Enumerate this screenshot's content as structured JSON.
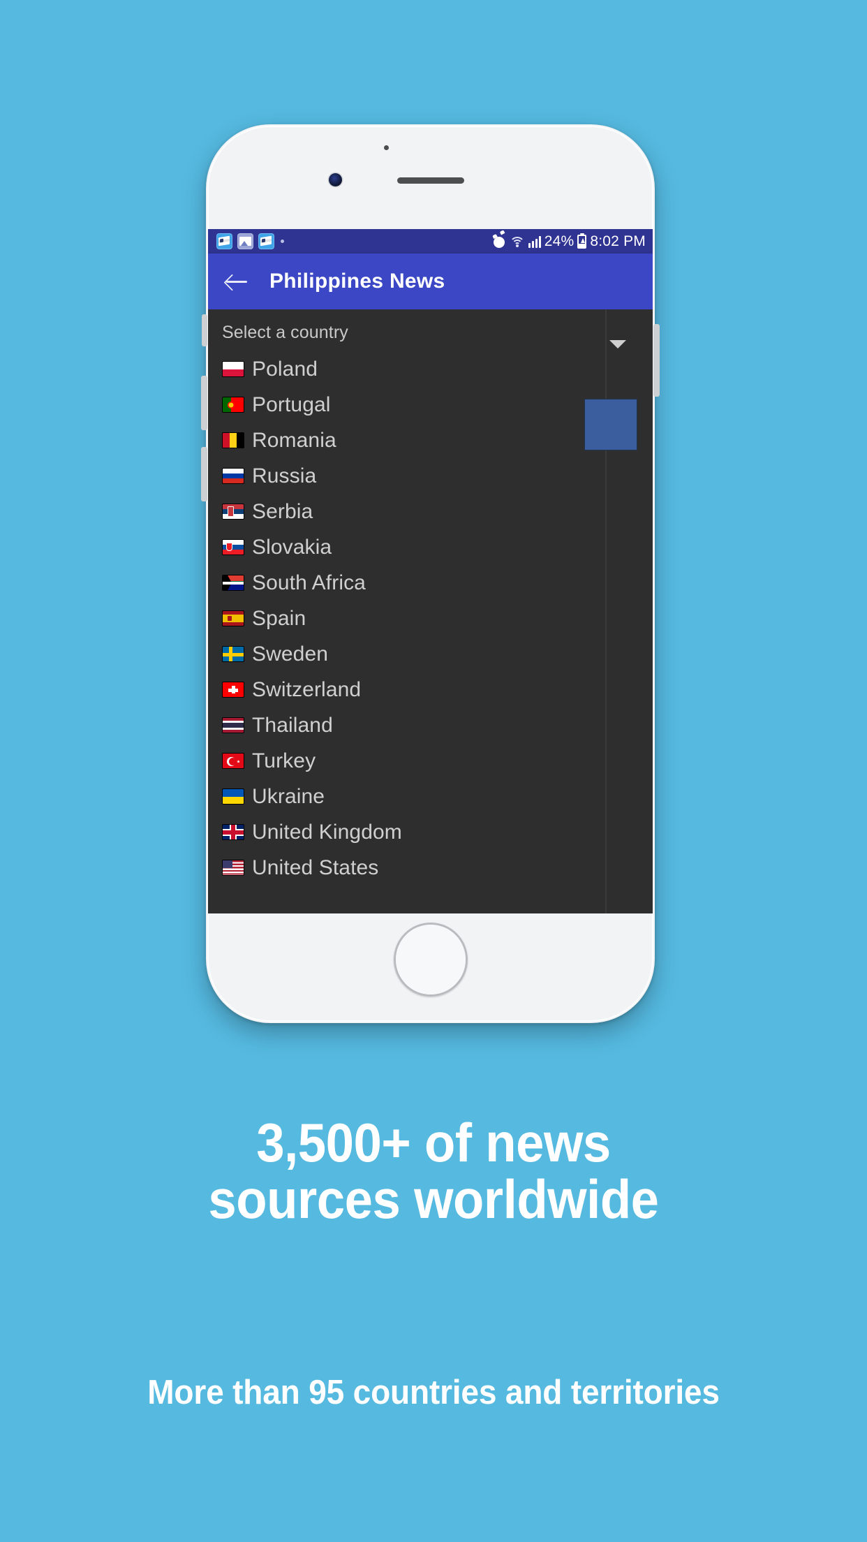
{
  "background_color": "#55b9e0",
  "phone": {
    "device": "white-smartphone-mockup",
    "home_button_name": "home-button"
  },
  "status_bar": {
    "background": "#2f3391",
    "notification_icons": [
      "news-paper-icon",
      "photo-icon",
      "news-paper-icon",
      "more-notifications-dot"
    ],
    "alarm_icon": "alarm-clock-icon",
    "wifi_icon": "wifi-icon",
    "signal_icon": "cell-signal-icon",
    "battery_percent": "24%",
    "battery_icon": "battery-charging-icon",
    "time": "8:02 PM"
  },
  "app_bar": {
    "background": "#3b47c4",
    "back_icon": "back-arrow-icon",
    "title": "Philippines News"
  },
  "dropdown": {
    "label": "Select a country",
    "chevron_icon": "chevron-down-icon",
    "scrollbar_color": "#3a5e9e",
    "countries": [
      {
        "name": "Poland",
        "flag": "f-poland",
        "stripes": 2
      },
      {
        "name": "Portugal",
        "flag": "f-portugal",
        "stripes": 2
      },
      {
        "name": "Romania",
        "flag": "f-romania",
        "stripes": 3
      },
      {
        "name": "Russia",
        "flag": "f-russia",
        "stripes": 3
      },
      {
        "name": "Serbia",
        "flag": "f-serbia",
        "stripes": 4
      },
      {
        "name": "Slovakia",
        "flag": "f-slovakia",
        "stripes": 4
      },
      {
        "name": "South Africa",
        "flag": "f-southafrica",
        "stripes": 4
      },
      {
        "name": "Spain",
        "flag": "f-spain",
        "stripes": 4
      },
      {
        "name": "Sweden",
        "flag": "f-sweden",
        "stripes": 2
      },
      {
        "name": "Switzerland",
        "flag": "f-switzerland",
        "stripes": 2
      },
      {
        "name": "Thailand",
        "flag": "f-thailand",
        "stripes": 5
      },
      {
        "name": "Turkey",
        "flag": "f-turkey",
        "stripes": 3
      },
      {
        "name": "Ukraine",
        "flag": "f-ukraine",
        "stripes": 2
      },
      {
        "name": "United Kingdom",
        "flag": "f-uk",
        "stripes": 4
      },
      {
        "name": "United States",
        "flag": "f-us",
        "stripes": 2
      }
    ]
  },
  "marketing": {
    "headline_line_1": "3,500+ of news",
    "headline_line_2": "sources worldwide",
    "subline": "More than 95 countries and territories"
  }
}
